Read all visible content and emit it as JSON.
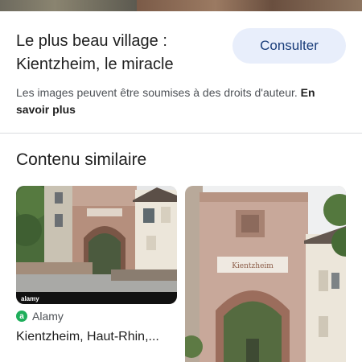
{
  "result": {
    "title": "Le plus beau village : Kientzheim, le miracle",
    "consult_label": "Consulter",
    "copyright_text": "Les images peuvent être soumises à des droits d'auteur.",
    "learn_more_label": "En savoir plus"
  },
  "similar": {
    "section_title": "Contenu similaire",
    "cards": [
      {
        "source_name": "Alamy",
        "source_icon_letter": "a",
        "watermark": "alamy",
        "caption": "Kientzheim, Haut-Rhin,..."
      },
      {
        "gate_sign": "Kientzheim"
      }
    ]
  },
  "colors": {
    "button_bg": "#e8eefb",
    "button_text": "#1a3d7a",
    "alamy_green": "#1fae5b"
  }
}
